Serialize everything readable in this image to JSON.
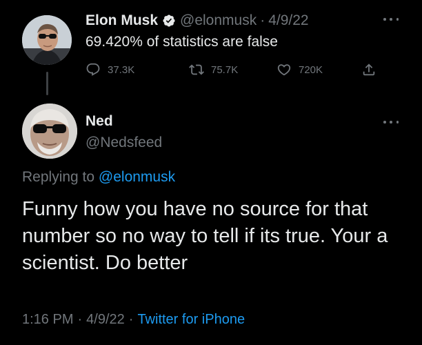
{
  "parent_tweet": {
    "author_name": "Elon Musk",
    "handle": "@elonmusk",
    "separator": "·",
    "date": "4/9/22",
    "text": "69.420% of statistics are false",
    "stats": {
      "replies": "37.3K",
      "retweets": "75.7K",
      "likes": "720K"
    },
    "verified_color": "#e7e9ea"
  },
  "main_tweet": {
    "author_name": "Ned",
    "handle": "@Nedsfeed",
    "replying_prefix": "Replying to",
    "replying_to": "@elonmusk",
    "text": "Funny how you have no source for that number so no way to tell if its true. Your a scientist. Do better",
    "time": "1:16 PM",
    "date": "4/9/22",
    "separator": "·",
    "source": "Twitter for iPhone"
  },
  "colors": {
    "background": "#000000",
    "text": "#e7e9ea",
    "muted": "#71767b",
    "link": "#1d9bf0"
  },
  "icons": [
    "reply-icon",
    "retweet-icon",
    "like-icon",
    "share-icon",
    "more-icon",
    "verified-badge-icon"
  ]
}
